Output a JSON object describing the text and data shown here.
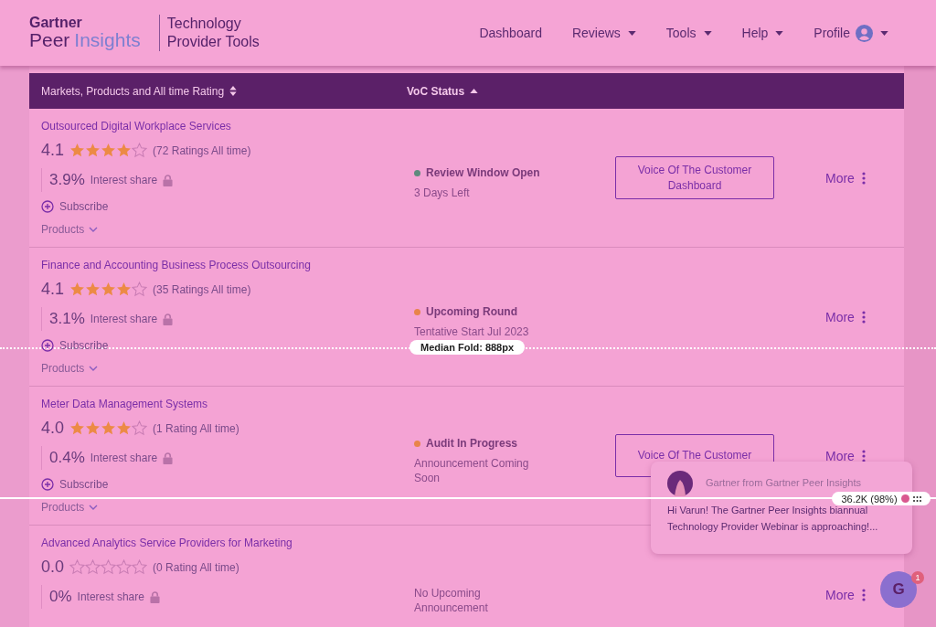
{
  "header": {
    "logo_top": "Gartner",
    "logo_word1": "Peer",
    "logo_word2": "Insights",
    "product_name": "Technology Provider Tools",
    "nav": [
      {
        "label": "Dashboard",
        "kind": "link"
      },
      {
        "label": "Reviews",
        "kind": "menu"
      },
      {
        "label": "Tools",
        "kind": "menu"
      },
      {
        "label": "Help",
        "kind": "menu"
      },
      {
        "label": "Profile",
        "kind": "profile"
      }
    ]
  },
  "table": {
    "columns": [
      {
        "label": "Markets, Products and All time Rating",
        "kind": "sortable"
      },
      {
        "label": "VoC Status",
        "kind": "sorted"
      }
    ],
    "rows": [
      {
        "market": "Outsourced Digital Workplace Services",
        "rating": "4.1",
        "stars": 4,
        "ratings_count": "(72 Ratings All time)",
        "interest": "3.9%",
        "interest_label": "Interest share",
        "subscribe": "Subscribe",
        "products": "Products",
        "status": {
          "title": "Review Window Open",
          "color": "#5f8a7d",
          "detail": "3 Days Left"
        },
        "voc_button": "Voice Of The Customer Dashboard",
        "more": "More"
      },
      {
        "market": "Finance and Accounting Business Process Outsourcing",
        "rating": "4.1",
        "stars": 4,
        "ratings_count": "(35 Ratings All time)",
        "interest": "3.1%",
        "interest_label": "Interest share",
        "subscribe": "Subscribe",
        "products": "Products",
        "status": {
          "title": "Upcoming Round",
          "color": "#e8844a",
          "detail": "Tentative Start Jul 2023"
        },
        "more": "More"
      },
      {
        "market": "Meter Data Management Systems",
        "rating": "4.0",
        "stars": 4,
        "ratings_count": "(1 Rating All time)",
        "interest": "0.4%",
        "interest_label": "Interest share",
        "subscribe": "Subscribe",
        "products": "Products",
        "status": {
          "title": "Audit In Progress",
          "color": "#e8844a",
          "detail": "Announcement Coming Soon"
        },
        "voc_button": "Voice Of The Customer",
        "more": "More"
      },
      {
        "market": "Advanced Analytics Service Providers for Marketing",
        "rating": "0.0",
        "stars": 0,
        "ratings_count": "(0 Rating All time)",
        "interest": "0%",
        "interest_label": "Interest share",
        "status": {
          "detail": "No Upcoming Announcement"
        },
        "more": "More"
      }
    ]
  },
  "heatmap_overlay": {
    "fold_label": "Median Fold: 888px",
    "attention_label": "36.2K (98%)"
  },
  "chat": {
    "sender": "Gartner from Gartner Peer Insights",
    "message": "Hi Varun! The Gartner Peer Insights biannual Technology Provider Webinar is approaching!...",
    "launcher_letter": "G",
    "badge": "1"
  }
}
